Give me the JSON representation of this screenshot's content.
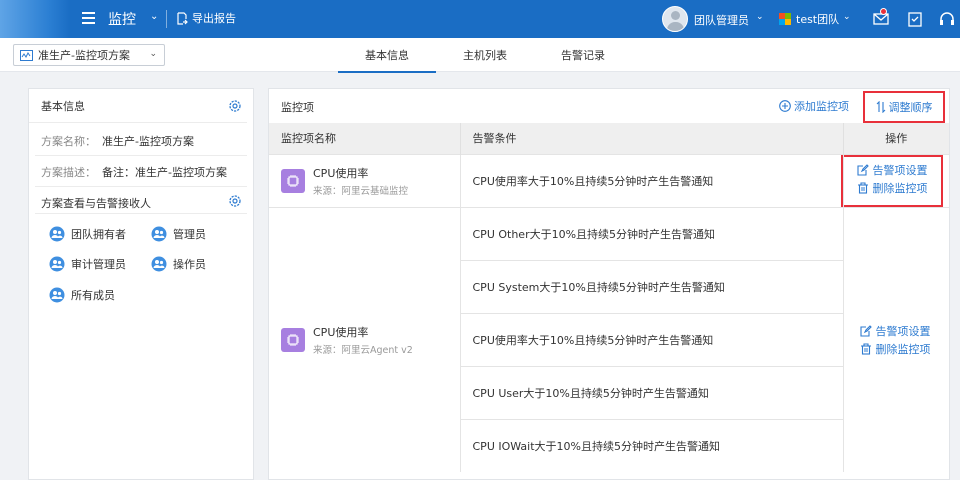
{
  "header": {
    "app_title": "监控",
    "export_label": "导出报告",
    "user_name": "团队管理员",
    "team_name": "test团队"
  },
  "subbar": {
    "plan_selected": "准生产-监控项方案",
    "tabs": [
      {
        "label": "基本信息",
        "active": true
      },
      {
        "label": "主机列表",
        "active": false
      },
      {
        "label": "告警记录",
        "active": false
      }
    ]
  },
  "left": {
    "title": "基本信息",
    "name_key": "方案名称：",
    "name_value": "准生产-监控项方案",
    "desc_key": "方案描述：",
    "desc_value": "备注：准生产-监控项方案",
    "recipients_title": "方案查看与告警接收人",
    "recipients": [
      "团队拥有者",
      "管理员",
      "审计管理员",
      "操作员",
      "所有成员"
    ]
  },
  "right": {
    "title": "监控项",
    "add_label": "添加监控项",
    "order_label": "调整顺序",
    "columns": [
      "监控项名称",
      "告警条件",
      "操作"
    ],
    "groups": [
      {
        "name": "CPU使用率",
        "source": "来源：阿里云基础监控",
        "conditions": [
          "CPU使用率大于10%且持续5分钟时产生告警通知"
        ],
        "ops": [
          "告警项设置",
          "删除监控项"
        ]
      },
      {
        "name": "CPU使用率",
        "source": "来源：阿里云Agent v2",
        "conditions": [
          "CPU Other大于10%且持续5分钟时产生告警通知",
          "CPU System大于10%且持续5分钟时产生告警通知",
          "CPU使用率大于10%且持续5分钟时产生告警通知",
          "CPU User大于10%且持续5分钟时产生告警通知",
          "CPU IOWait大于10%且持续5分钟时产生告警通知"
        ],
        "ops": [
          "告警项设置",
          "删除监控项"
        ]
      }
    ]
  },
  "colors": {
    "brand": "#1a6dc4",
    "link": "#2e7bd0",
    "highlight": "#e8303a",
    "cpu_icon": "#a77fe0"
  },
  "icons": [
    "menu-icon",
    "export-icon",
    "avatar-icon",
    "team-logo-icon",
    "mail-icon",
    "checklist-icon",
    "headset-icon",
    "chart-icon",
    "gear-icon",
    "user-group-icon",
    "plus-circle-icon",
    "sort-icon",
    "cpu-icon",
    "edit-icon",
    "trash-icon"
  ]
}
